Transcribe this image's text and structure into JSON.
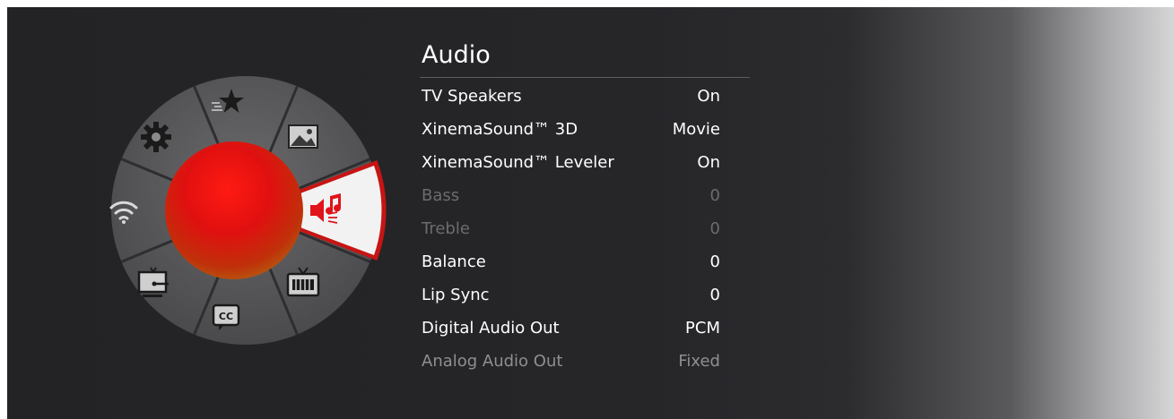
{
  "wheel": {
    "segments": [
      {
        "icon": "star-icon",
        "selected": false
      },
      {
        "icon": "picture-icon",
        "selected": false
      },
      {
        "icon": "audio-icon",
        "selected": true
      },
      {
        "icon": "tv-icon",
        "selected": false
      },
      {
        "icon": "closed-captions-icon",
        "selected": false,
        "label": "CC"
      },
      {
        "icon": "input-source-icon",
        "selected": false
      },
      {
        "icon": "wifi-icon",
        "selected": false
      },
      {
        "icon": "gear-icon",
        "selected": false
      }
    ],
    "center_orb_color": "#e01010",
    "selected_segment_color": "#c81414"
  },
  "menu": {
    "title": "Audio",
    "items": [
      {
        "label": "TV Speakers",
        "value": "On",
        "state": "enabled"
      },
      {
        "label": "XinemaSound™ 3D",
        "value": "Movie",
        "state": "enabled"
      },
      {
        "label": "XinemaSound™ Leveler",
        "value": "On",
        "state": "enabled"
      },
      {
        "label": "Bass",
        "value": "0",
        "state": "disabled"
      },
      {
        "label": "Treble",
        "value": "0",
        "state": "disabled"
      },
      {
        "label": "Balance",
        "value": "0",
        "state": "enabled"
      },
      {
        "label": "Lip Sync",
        "value": "0",
        "state": "enabled"
      },
      {
        "label": "Digital Audio Out",
        "value": "PCM",
        "state": "enabled"
      },
      {
        "label": "Analog Audio Out",
        "value": "Fixed",
        "state": "faded"
      }
    ]
  }
}
